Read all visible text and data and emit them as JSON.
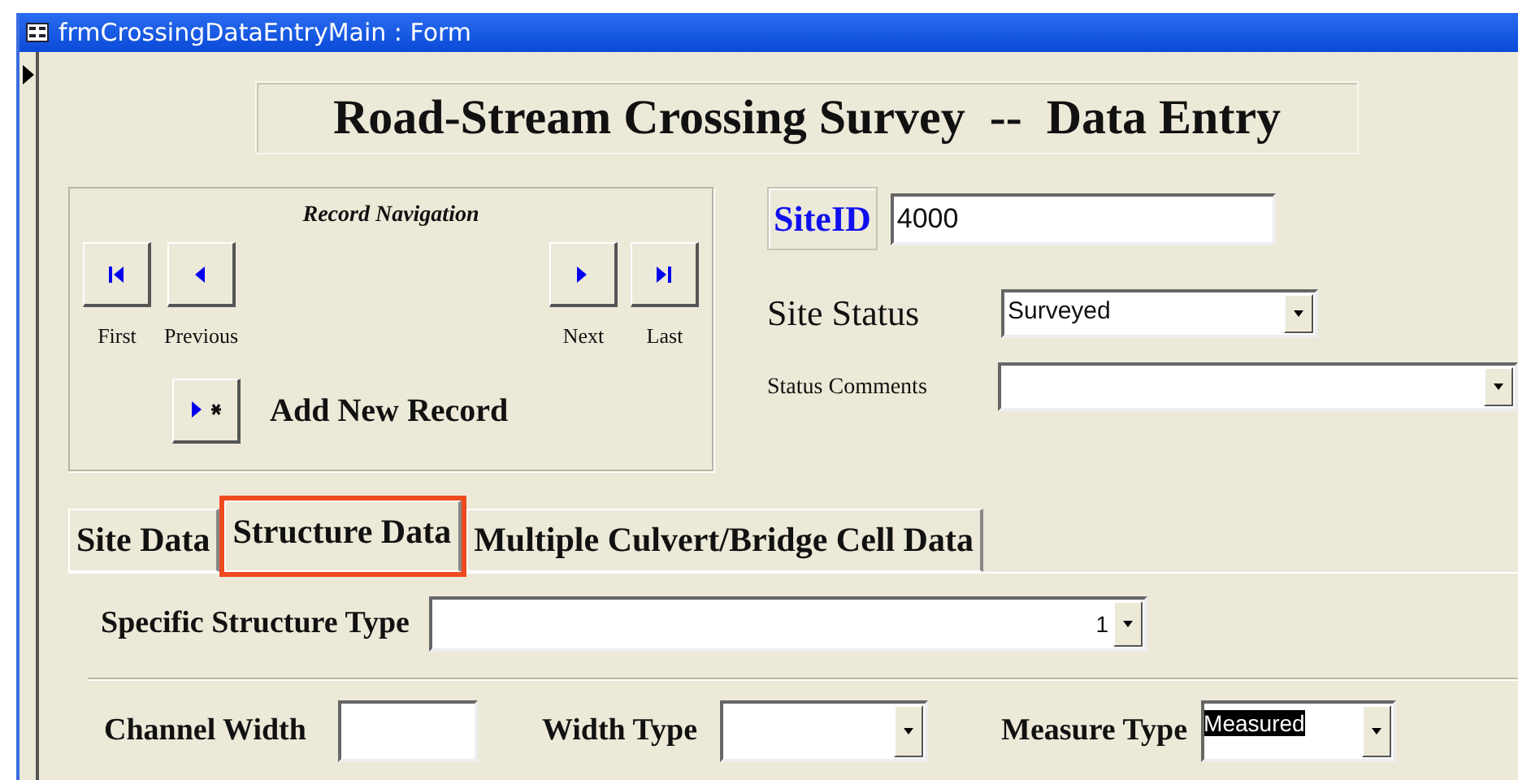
{
  "window": {
    "title": "frmCrossingDataEntryMain : Form"
  },
  "form": {
    "title": "Road-Stream Crossing Survey  --  Data Entry",
    "navigation": {
      "heading": "Record  Navigation",
      "buttons": [
        {
          "kind": "first",
          "label": "First"
        },
        {
          "kind": "previous",
          "label": "Previous"
        },
        {
          "kind": "next",
          "label": "Next"
        },
        {
          "kind": "last",
          "label": "Last"
        }
      ],
      "add_new_label": "Add New Record"
    },
    "site_id": {
      "label": "SiteID",
      "value": "4000"
    },
    "site_status": {
      "label": "Site Status",
      "value": "Surveyed"
    },
    "status_comments": {
      "label": "Status Comments"
    },
    "tabs": [
      {
        "label": "Site Data",
        "selected": false,
        "annotated": false
      },
      {
        "label": "Structure Data",
        "selected": true,
        "annotated": true
      },
      {
        "label": "Multiple Culvert/Bridge Cell Data",
        "selected": false,
        "annotated": false
      }
    ],
    "specific_structure_type": {
      "label": "Specific Structure Type",
      "value": "1"
    },
    "channel_width": {
      "label": "Channel Width"
    },
    "width_type": {
      "label": "Width Type"
    },
    "measure_type": {
      "label": "Measure Type",
      "value": "Measured",
      "highlighted": true
    }
  }
}
